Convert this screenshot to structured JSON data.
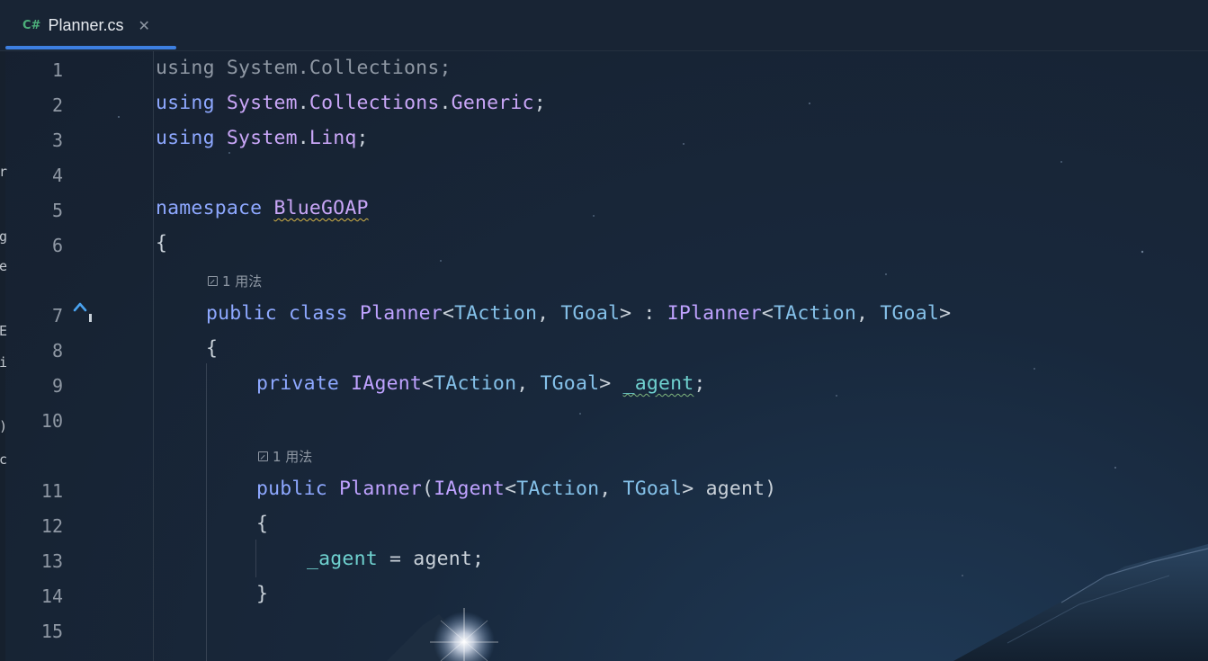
{
  "tab": {
    "icon": "C#",
    "title": "Planner.cs",
    "close_glyph": "✕",
    "icon_color": "#4caf7a",
    "underline_color": "#3d7fe0"
  },
  "left_panel_fragments": [
    "r",
    "g",
    "e",
    "E",
    "i",
    ")",
    "c"
  ],
  "line_numbers": [
    "1",
    "2",
    "3",
    "4",
    "5",
    "6",
    "7",
    "8",
    "9",
    "10",
    "11",
    "12",
    "13",
    "14",
    "15"
  ],
  "usage_hints": [
    "1 用法",
    "1 用法"
  ],
  "code": {
    "l1": [
      "using",
      " System.Collections;"
    ],
    "l2": [
      "using",
      " ",
      "System",
      ".",
      "Collections",
      ".",
      "Generic",
      ";"
    ],
    "l3": [
      "using",
      " ",
      "System",
      ".",
      "Linq",
      ";"
    ],
    "l5": [
      "namespace",
      " ",
      "BlueGOAP"
    ],
    "l6": [
      "{"
    ],
    "l7": [
      "public",
      " ",
      "class",
      " ",
      "Planner",
      "<",
      "TAction",
      ", ",
      "TGoal",
      "> : ",
      "IPlanner",
      "<",
      "TAction",
      ", ",
      "TGoal",
      ">"
    ],
    "l8": [
      "{"
    ],
    "l9": [
      "private",
      " ",
      "IAgent",
      "<",
      "TAction",
      ", ",
      "TGoal",
      "> ",
      "_agent",
      ";"
    ],
    "l11": [
      "public",
      " ",
      "Planner",
      "(",
      "IAgent",
      "<",
      "TAction",
      ", ",
      "TGoal",
      "> agent)"
    ],
    "l12": [
      "{"
    ],
    "l13": [
      "_agent",
      " = agent;"
    ],
    "l14": [
      "}"
    ]
  },
  "icons": {
    "file_type": "csharp-icon",
    "close": "close-icon",
    "inherit": "implemented-interface-icon",
    "usage": "external-link-icon"
  },
  "colors": {
    "keyword": "#8ea8ff",
    "type": "#bfa2ff",
    "type_param": "#85c1e9",
    "field": "#6fd1cf",
    "text": "#c9d1d9",
    "line_number": "#8f98a4",
    "background": "#172333"
  }
}
